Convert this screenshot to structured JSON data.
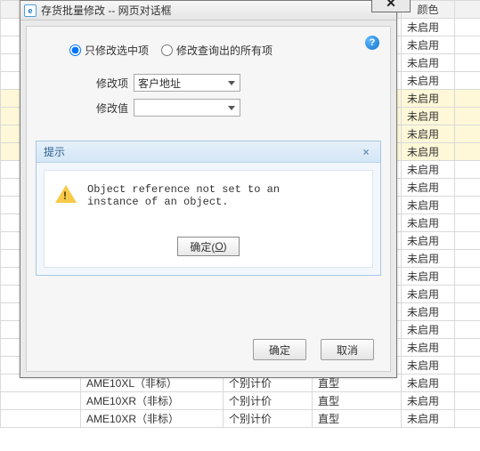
{
  "dialog": {
    "title": "存货批量修改 -- 网页对话框",
    "close_x": "✕",
    "help_glyph": "?",
    "radio": {
      "selected_only": "只修改选中项",
      "all_query": "修改查询出的所有项"
    },
    "form": {
      "modify_item_label": "修改项",
      "modify_item_value": "客户地址",
      "modify_value_label": "修改值",
      "modify_value_value": ""
    },
    "buttons": {
      "ok": "确定",
      "cancel": "取消"
    }
  },
  "prompt": {
    "title": "提示",
    "close_glyph": "×",
    "message": "Object reference not set to an instance of an object.",
    "ok_label_prefix": "确定(",
    "ok_label_hotkey": "O",
    "ok_label_suffix": ")"
  },
  "bg": {
    "headers": {
      "color": "颜色"
    },
    "status": "未启用",
    "rows": [
      {
        "code": "AME10XL（非标）",
        "price": "个别计价",
        "shape": "直型"
      },
      {
        "code": "AME10XR（非标）",
        "price": "个别计价",
        "shape": "直型"
      },
      {
        "code": "AME10XR（非标）",
        "price": "个别计价",
        "shape": "直型"
      }
    ]
  }
}
